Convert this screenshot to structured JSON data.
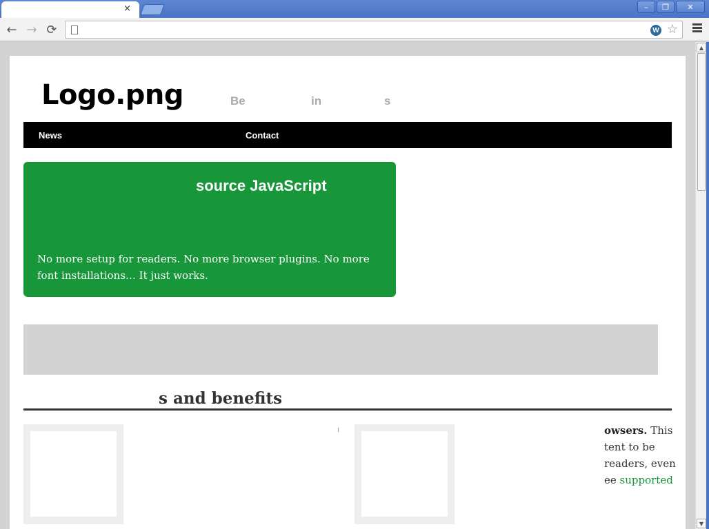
{
  "browser": {
    "tab_close": "×",
    "win_minimize": "–",
    "win_restore": "❐",
    "win_close": "✕",
    "back": "←",
    "forward": "→",
    "reload": "⟳",
    "address_value": "",
    "wp_badge": "W",
    "star": "☆"
  },
  "site": {
    "logo": "Logo.png",
    "tagline_parts": [
      "Be",
      "in",
      "s"
    ],
    "nav": [
      "News",
      "Contact"
    ],
    "hero_title": "source JavaScript",
    "hero_text": "No more setup for readers. No more browser plugins. No more font installations… It just works.",
    "section_title": "s and benefits",
    "feature_text": {
      "bold": "owsers.",
      "after_bold": " This",
      "line2": "tent to be",
      "line3": "readers, even",
      "line4_prefix": "ee ",
      "line4_link": "supported"
    }
  },
  "scrollbar": {
    "up": "▲",
    "down": "▼"
  }
}
